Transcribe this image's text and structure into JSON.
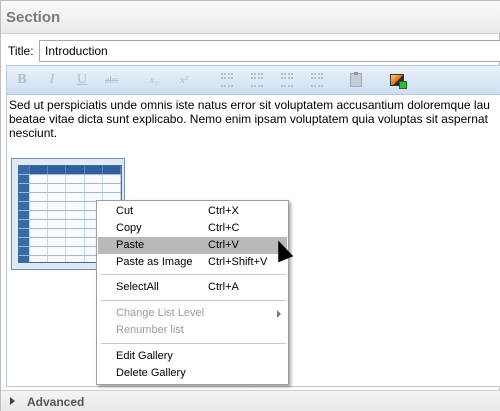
{
  "section": {
    "title": "Section"
  },
  "title_field": {
    "label": "Title:",
    "value": "Introduction"
  },
  "toolbar": {
    "items": [
      {
        "name": "bold",
        "label": "B"
      },
      {
        "name": "italic",
        "label": "I"
      },
      {
        "name": "underline",
        "label": "U"
      },
      {
        "name": "strikethrough",
        "label": "abc"
      },
      {
        "name": "subscript",
        "label": "x₂"
      },
      {
        "name": "superscript",
        "label": "x²"
      },
      {
        "name": "bulleted-list",
        "label": ""
      },
      {
        "name": "numbered-list",
        "label": ""
      },
      {
        "name": "indent",
        "label": ""
      },
      {
        "name": "outdent",
        "label": ""
      },
      {
        "name": "clipboard-paste",
        "label": ""
      },
      {
        "name": "insert-image",
        "label": ""
      }
    ]
  },
  "content": {
    "text": "Sed ut perspiciatis unde omnis iste natus error sit voluptatem accusantium doloremque lau beatae vitae dicta sunt explicabo. Nemo enim ipsam voluptatem quia voluptas sit aspernat nesciunt."
  },
  "context_menu": {
    "items": [
      {
        "label": "Cut",
        "shortcut": "Ctrl+X"
      },
      {
        "label": "Copy",
        "shortcut": "Ctrl+C"
      },
      {
        "label": "Paste",
        "shortcut": "Ctrl+V"
      },
      {
        "label": "Paste as Image",
        "shortcut": "Ctrl+Shift+V"
      },
      {
        "label": "SelectAll",
        "shortcut": "Ctrl+A"
      },
      {
        "label": "Change List Level",
        "shortcut": ""
      },
      {
        "label": "Renumber list",
        "shortcut": ""
      },
      {
        "label": "Edit Gallery",
        "shortcut": ""
      },
      {
        "label": "Delete Gallery",
        "shortcut": ""
      }
    ]
  },
  "advanced": {
    "label": "Advanced"
  }
}
